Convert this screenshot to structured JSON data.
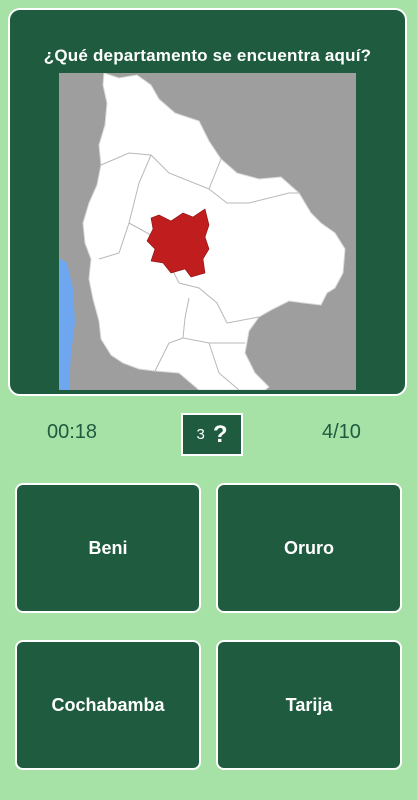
{
  "question": "¿Qué departamento se encuentra aquí?",
  "map": {
    "highlighted_region_color": "#c01e1e",
    "country_color": "#ffffff",
    "neighbor_color": "#9e9e9e",
    "water_color": "#6fa6f0"
  },
  "status": {
    "timer": "00:18",
    "hint_count": "3",
    "hint_symbol": "?",
    "progress": "4/10"
  },
  "answers": [
    {
      "label": "Beni"
    },
    {
      "label": "Oruro"
    },
    {
      "label": "Cochabamba"
    },
    {
      "label": "Tarija"
    }
  ],
  "colors": {
    "background": "#a6e1a6",
    "card": "#1e5b3f",
    "border": "#ffffff"
  }
}
